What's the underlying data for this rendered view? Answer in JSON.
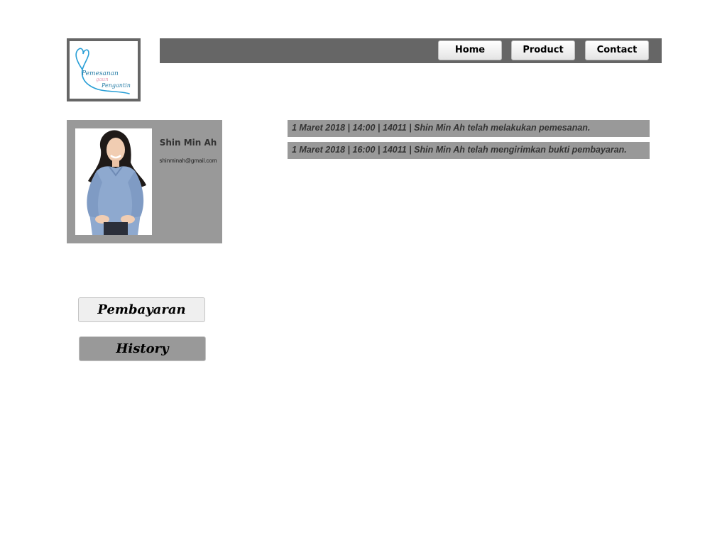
{
  "logo": {
    "line1": "Pemesanan",
    "line2": "gaun",
    "line3": "Pengantin",
    "accent_color": "#2a9fd6"
  },
  "nav": {
    "items": [
      {
        "label": "Home"
      },
      {
        "label": "Product"
      },
      {
        "label": "Contact"
      }
    ]
  },
  "profile": {
    "name": "Shin Min Ah",
    "email": "shinminah@gmail.com"
  },
  "sidebar": {
    "pembayaran_label": "Pembayaran",
    "history_label": "History"
  },
  "history": {
    "entries": [
      {
        "text": "1 Maret 2018 | 14:00 | 14011 | Shin Min Ah telah melakukan pemesanan."
      },
      {
        "text": "1 Maret 2018 | 16:00 | 14011 | Shin Min Ah telah mengirimkan bukti pembayaran."
      }
    ]
  },
  "colors": {
    "header_bar": "#666666",
    "panel_gray": "#999999",
    "active_button": "#999999"
  }
}
